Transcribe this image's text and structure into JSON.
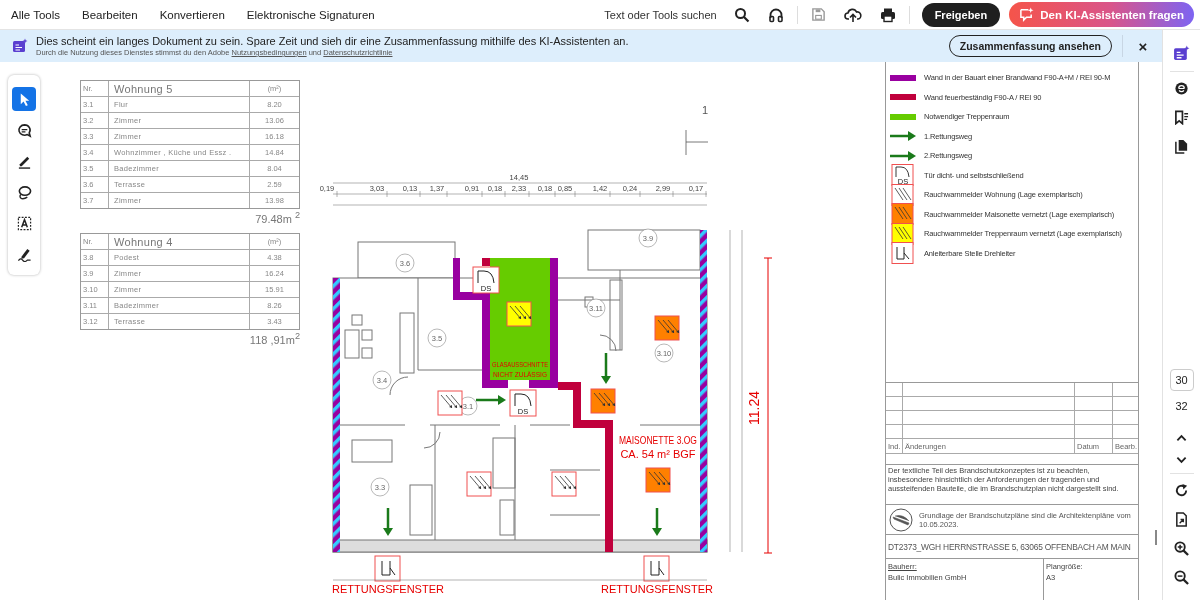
{
  "menu": [
    {
      "label": "Alle Tools"
    },
    {
      "label": "Bearbeiten"
    },
    {
      "label": "Konvertieren"
    },
    {
      "label": "Elektronische Signaturen"
    }
  ],
  "search": {
    "label": "Text oder Tools suchen"
  },
  "share_button": "Freigeben",
  "ai_button": "Den KI-Assistenten fragen",
  "banner": {
    "message": "Dies scheint ein langes Dokument zu sein. Spare Zeit und sieh dir eine Zusammenfassung mithilfe des KI-Assistenten an.",
    "notice": "Durch die Nutzung dieses Dienstes stimmst du den Adobe",
    "terms_link": "Nutzungsbedingungen",
    "conjunction": "und",
    "privacy_link": "Datenschutzrichtlinie",
    "button": "Zusammenfassung ansehen",
    "close": "×"
  },
  "tools": [
    {
      "kind": "select",
      "selected": true
    },
    {
      "kind": "comment",
      "selected": false
    },
    {
      "kind": "pen",
      "selected": false
    },
    {
      "kind": "lasso",
      "selected": false
    },
    {
      "kind": "text",
      "selected": false
    },
    {
      "kind": "sign",
      "selected": false
    }
  ],
  "document": {
    "area_tables": [
      {
        "nr_header": "Nr.",
        "title": "Wohnung 5",
        "unit": "(m²)",
        "total": "79.48m $^{2}$",
        "rows": [
          {
            "nr": "3.1",
            "room": "Flur",
            "area": "8.20"
          },
          {
            "nr": "3.2",
            "room": "Zimmer",
            "area": "13.06"
          },
          {
            "nr": "3.3",
            "room": "Zimmer",
            "area": "16.18"
          },
          {
            "nr": "3.4",
            "room": "Wohnzimmer , Küche und Essz .",
            "area": "14.84"
          },
          {
            "nr": "3.5",
            "room": "Badezimmer",
            "area": "8.04"
          },
          {
            "nr": "3.6",
            "room": "Terrasse",
            "area": "2.59"
          },
          {
            "nr": "3.7",
            "room": "Zimmer",
            "area": "13.98"
          }
        ]
      },
      {
        "nr_header": "Nr.",
        "title": "Wohnung 4",
        "unit": "(m²)",
        "total": "118 ,91m$^{2}$",
        "rows": [
          {
            "nr": "3.8",
            "room": "Podest",
            "area": "4.38"
          },
          {
            "nr": "3.9",
            "room": "Zimmer",
            "area": "16.24"
          },
          {
            "nr": "3.10",
            "room": "Zimmer",
            "area": "15.91"
          },
          {
            "nr": "3.11",
            "room": "Badezimmer",
            "area": "8.26"
          },
          {
            "nr": "3.12",
            "room": "Terrasse",
            "area": "3.43"
          }
        ]
      }
    ],
    "plan": {
      "section_mark": "1",
      "overall_dimension": "14,45",
      "dimension_row": [
        "0,19",
        "3,03",
        "0,13",
        "1,37",
        "0,91",
        "0,18",
        "2,33",
        "0,18",
        "0,85",
        "1,42",
        "0,24",
        "2,99",
        "0,17"
      ],
      "height_dimension": "11.24",
      "stair_note": [
        "GLASAUSSCHNITTE",
        "NICHT ZULÄSSIG"
      ],
      "unit_note": [
        "MAISONETTE 3.OG",
        "CA. 54 m² BGF"
      ],
      "rooms": [
        "3.6",
        "3.5",
        "3.4",
        "3.1",
        "3.3",
        "3.9",
        "3.11",
        "3.10"
      ],
      "doors": [
        {
          "label": "DS"
        },
        {
          "label": "DS"
        }
      ],
      "detectors": [
        {
          "color": "#ffff00"
        },
        {
          "color": "#ff8000"
        },
        {
          "color": "#ff8000"
        },
        {
          "color": "#ff8000"
        },
        {
          "color": "#ffffff"
        },
        {
          "color": "#ffffff"
        },
        {
          "color": "#ffffff"
        }
      ],
      "rescue_windows": [
        {
          "label": "RETTUNGSFENSTER"
        },
        {
          "label": "RETTUNGSFENSTER"
        }
      ]
    },
    "legend": [
      {
        "kind": "wall",
        "color": "#9900a0",
        "label": "Wand in der Bauart einer Brandwand F90-A+M / REI 90-M"
      },
      {
        "kind": "wall",
        "color": "#c0003c",
        "label": "Wand feuerbeständig F90-A / REI 90"
      },
      {
        "kind": "wall",
        "color": "#66cc00",
        "label": "Notwendiger Treppenraum"
      },
      {
        "kind": "arrow",
        "label": "1.Rettungsweg"
      },
      {
        "kind": "arrow",
        "label": "2.Rettungsweg"
      },
      {
        "kind": "door",
        "symbol_text": "DS",
        "label": "Tür dicht- und selbstschließend"
      },
      {
        "kind": "detector",
        "color": "#ffffff",
        "label": "Rauchwarnmelder Wohnung (Lage exemplarisch)"
      },
      {
        "kind": "detector",
        "color": "#ff8000",
        "label": "Rauchwarnmelder Maisonette vernetzt (Lage exemplarisch)"
      },
      {
        "kind": "detector",
        "color": "#ffff00",
        "label": "Rauchwarnmelder Treppenraum vernetzt (Lage exemplarisch)"
      },
      {
        "kind": "ladder",
        "label": "Anleiterbare Stelle Drehleiter"
      }
    ],
    "title_block": {
      "columns": [
        "Ind.",
        "Änderungen",
        "Datum",
        "Bearb."
      ],
      "note": "Der textliche Teil des Brandschutzkonzeptes ist zu beachten, insbesondere hinsichtlich der Anforderungen der tragenden und aussteifenden Bauteile, die im Brandschutzplan nicht dargestellt sind.",
      "basis": "Grundlage der Brandschutzpläne sind die Architektenpläne vom 10.05.2023.",
      "project": "DT2373_WGH HERRNSTRASSE 5, 63065 OFFENBACH AM MAIN",
      "client_label": "Bauherr:",
      "client": "Bulic Immobilien GmbH",
      "size_label": "Plangröße:",
      "size": "A3"
    }
  },
  "sidebar": {
    "pages": [
      {
        "label": "30",
        "selected": true
      },
      {
        "label": "32",
        "selected": false
      }
    ]
  }
}
